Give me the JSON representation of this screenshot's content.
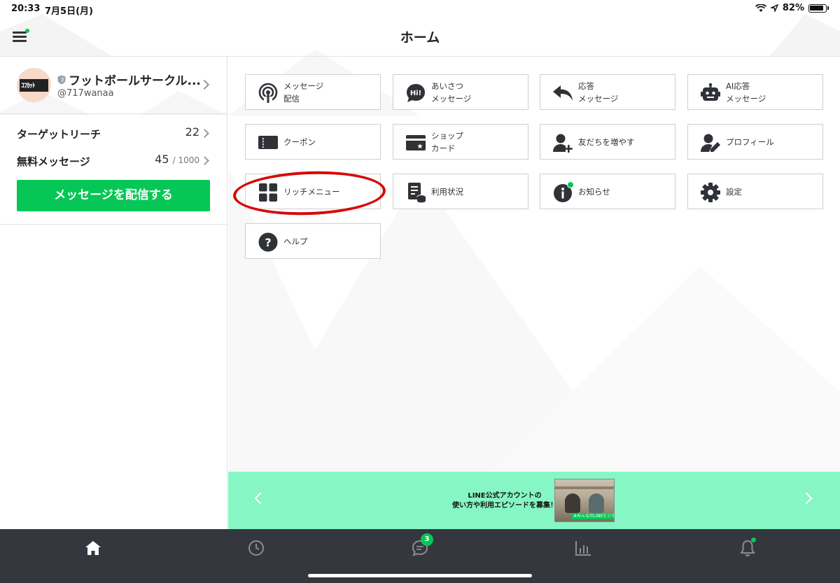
{
  "status_bar": {
    "time": "20:33",
    "date": "7月5日(月)",
    "battery": "82%"
  },
  "header": {
    "title": "ホーム"
  },
  "account": {
    "name": "フットボールサークル...",
    "id": "@717wanaa",
    "avatar_text": "ｺﾌｶｯﾄ"
  },
  "stats": {
    "target_reach": {
      "label": "ターゲットリーチ",
      "value": "22"
    },
    "free_messages": {
      "label": "無料メッセージ",
      "value": "45",
      "limit": "/ 1000"
    }
  },
  "send_button": "メッセージを配信する",
  "tiles": [
    {
      "label": "メッセージ\n配信",
      "icon": "broadcast-icon"
    },
    {
      "label": "あいさつ\nメッセージ",
      "icon": "greeting-icon"
    },
    {
      "label": "応答\nメッセージ",
      "icon": "reply-icon"
    },
    {
      "label": "AI応答\nメッセージ",
      "icon": "robot-icon"
    },
    {
      "label": "クーポン",
      "icon": "coupon-icon"
    },
    {
      "label": "ショップ\nカード",
      "icon": "shop-card-icon"
    },
    {
      "label": "友だちを増やす",
      "icon": "add-friend-icon"
    },
    {
      "label": "プロフィール",
      "icon": "profile-icon"
    },
    {
      "label": "リッチメニュー",
      "icon": "rich-menu-icon"
    },
    {
      "label": "利用状況",
      "icon": "usage-icon"
    },
    {
      "label": "お知らせ",
      "icon": "info-icon"
    },
    {
      "label": "設定",
      "icon": "gear-icon"
    },
    {
      "label": "ヘルプ",
      "icon": "help-icon"
    }
  ],
  "banner": {
    "line1": "LINE公式アカウントの",
    "line2": "使い方や利用エピソードを募集！",
    "photo_tag": "#みんなのLINEビジネス"
  },
  "tabbar": {
    "chat_badge": "3",
    "items": [
      "home-icon",
      "clock-icon",
      "chat-icon",
      "chart-icon",
      "bell-icon"
    ]
  },
  "colors": {
    "accent": "#06c755",
    "banner_bg": "#86f7c4",
    "tabbar_bg": "#34373d",
    "annotation": "#d60a0a"
  }
}
